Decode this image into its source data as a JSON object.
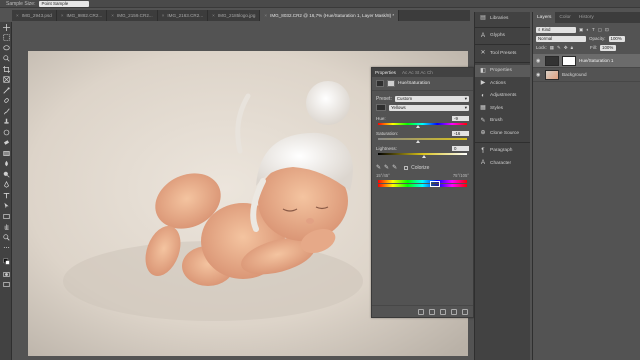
{
  "options_bar": {
    "sample_size_label": "Sample Size:",
    "sample_size_value": "Point Sample"
  },
  "tabs": [
    {
      "label": "IMG_2943.psd",
      "active": false
    },
    {
      "label": "IMG_9882.CR2...",
      "active": false
    },
    {
      "label": "IMG_2159.CR2...",
      "active": false
    },
    {
      "label": "IMG_2163.CR2...",
      "active": false
    },
    {
      "label": "IMG_2185logo.jpg",
      "active": false
    },
    {
      "label": "IMG_8032.CR2 @ 16,7% (Hue/Saturation 1, Layer Mask/8) *",
      "active": true
    }
  ],
  "properties": {
    "tab_active": "Properties",
    "tab_others": "Ac  Ac  St  Ac  Ch",
    "adjustment_title": "Hue/Saturation",
    "preset_label": "Preset:",
    "preset_value": "Custom",
    "channel_value": "Yellows",
    "hue_label": "Hue:",
    "hue_value": "-9",
    "saturation_label": "Saturation:",
    "saturation_value": "-16",
    "lightness_label": "Lightness:",
    "lightness_value": "0",
    "colorize_label": "Colorize",
    "range_left": "15°/45°",
    "range_right": "75°/105°"
  },
  "panel_strip": [
    {
      "label": "Libraries",
      "icon": "libraries-icon"
    },
    {
      "label": "Glyphs",
      "icon": "glyphs-icon"
    },
    {
      "label": "Tool Presets",
      "icon": "tool-presets-icon"
    },
    {
      "label": "Properties",
      "icon": "properties-icon",
      "selected": true
    },
    {
      "label": "Actions",
      "icon": "actions-icon"
    },
    {
      "label": "Adjustments",
      "icon": "adjustments-icon"
    },
    {
      "label": "Styles",
      "icon": "styles-icon"
    },
    {
      "label": "Brush",
      "icon": "brush-icon"
    },
    {
      "label": "Clone Source",
      "icon": "clone-source-icon"
    },
    {
      "label": "Paragraph",
      "icon": "paragraph-icon"
    },
    {
      "label": "Character",
      "icon": "character-icon"
    }
  ],
  "layers_panel": {
    "tabs": [
      "Layers",
      "Color",
      "History"
    ],
    "kind_label": "Kind",
    "blend_mode": "Normal",
    "opacity_label": "Opacity:",
    "opacity_value": "100%",
    "lock_label": "Lock:",
    "fill_label": "Fill:",
    "fill_value": "100%",
    "layers": [
      {
        "name": "Hue/Saturation 1",
        "active": true
      },
      {
        "name": "Background",
        "active": false
      }
    ]
  }
}
